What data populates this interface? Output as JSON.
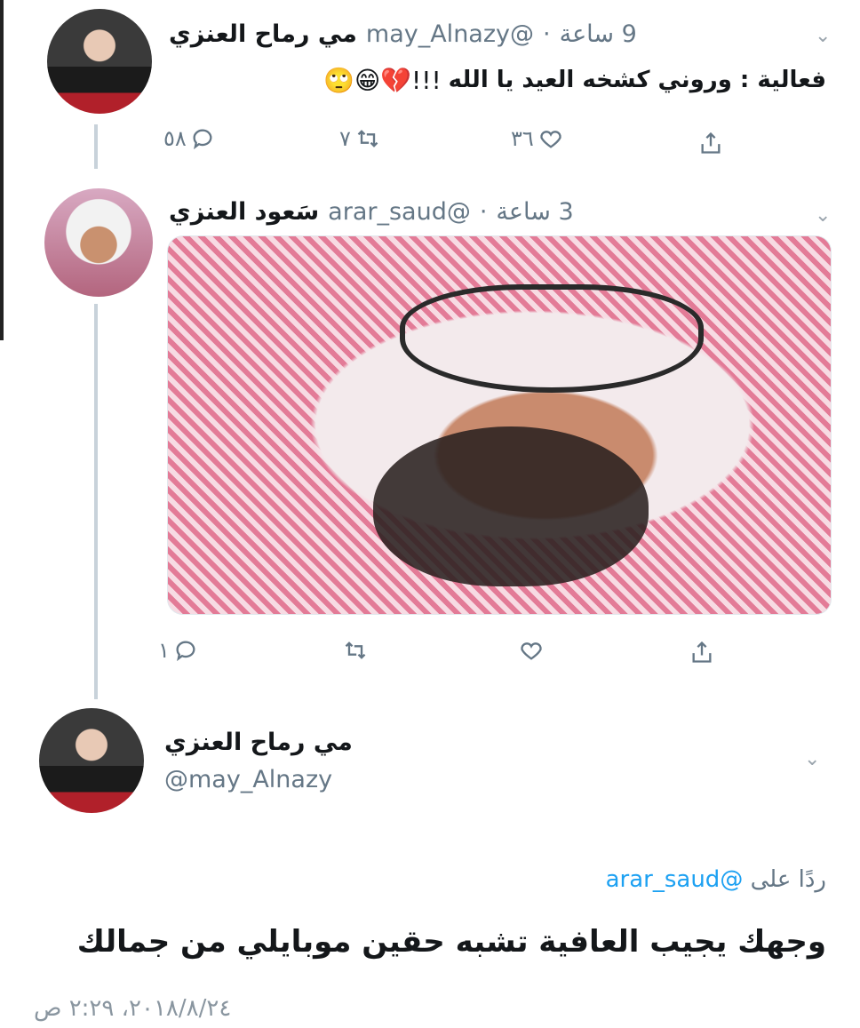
{
  "tweet1": {
    "display_name": "مي رماح العنزي",
    "handle": "@may_Alnazy",
    "time": "9 ساعة",
    "text": "فعالية : وروني كشخه العيد يا الله",
    "emojis": "🙄😁💔!!!",
    "reply_count": "٥٨",
    "retweet_count": "٧",
    "like_count": "٣٦"
  },
  "tweet2": {
    "display_name": "سَعود العنزي",
    "handle": "@arar_saud",
    "time": "3 ساعة",
    "reply_count": "١"
  },
  "reply": {
    "display_name": "مي رماح العنزي",
    "handle": "@may_Alnazy",
    "replying_to_label": "ردًا على",
    "replying_to_handle": "@arar_saud",
    "text": "وجهك يجيب العافية تشبه حقين موبايلي من جمالك",
    "timestamp": "٢٠١٨/٨/٢٤، ٢:٢٩ ص"
  },
  "icons": {
    "chevron": "chevron-down-icon",
    "reply": "reply-icon",
    "retweet": "retweet-icon",
    "like": "heart-icon",
    "share": "share-icon"
  }
}
